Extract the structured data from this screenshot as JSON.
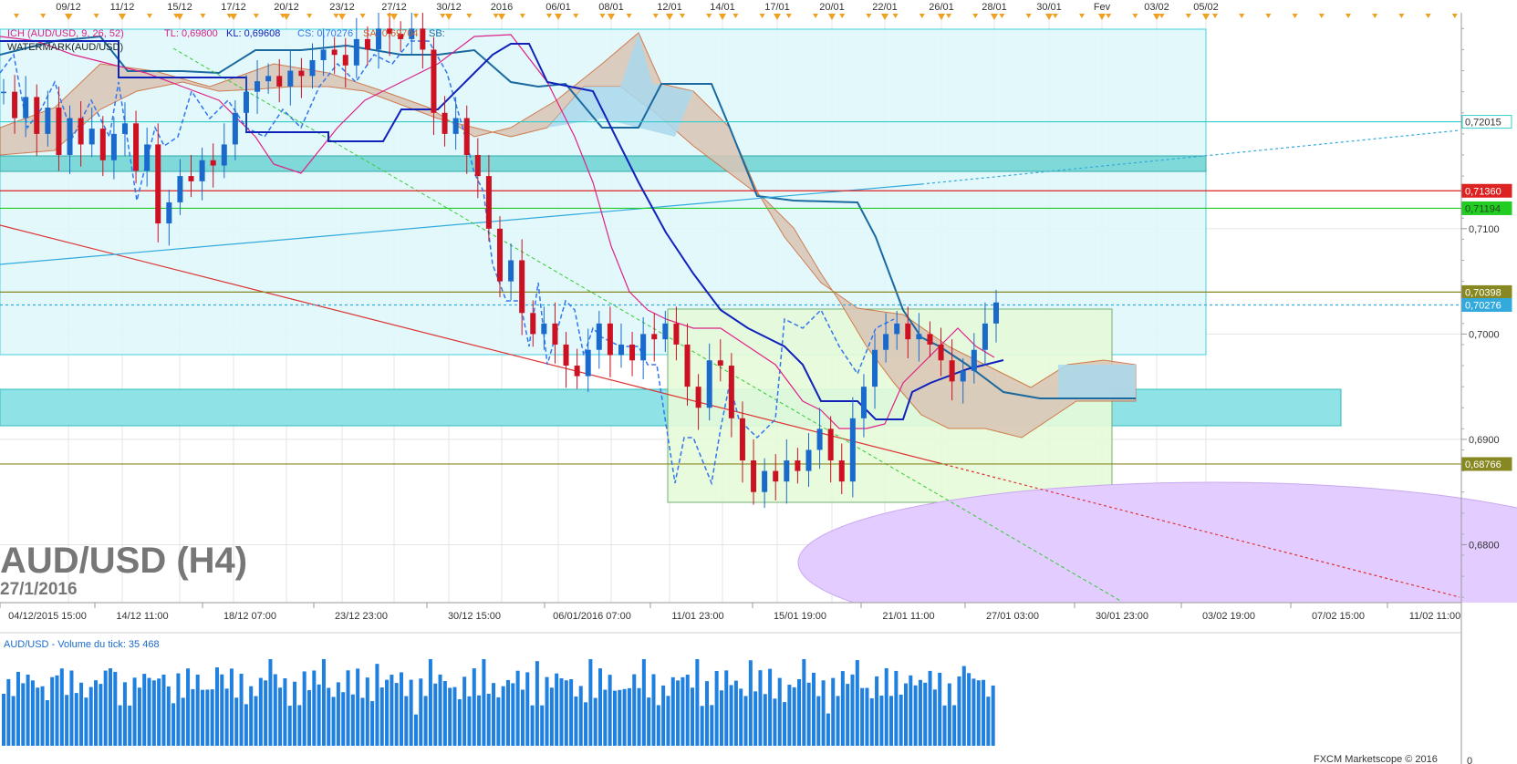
{
  "chart_data": {
    "type": "candlestick",
    "symbol_title": "AUD/USD (H4)",
    "date_label": "27/1/2016",
    "indicator_legend": {
      "ich": "ICH (AUD/USD, 9, 26, 52)",
      "tl": "TL: 0,69800",
      "kl": "KL: 0,69608",
      "cs": "CS: 0,70276",
      "sa": "SA: 0,69704",
      "sb": "SB:",
      "watermark": "WATERMARK(AUD/USD)"
    },
    "top_dates": [
      "09/12",
      "11/12",
      "15/12",
      "17/12",
      "20/12",
      "23/12",
      "27/12",
      "30/12",
      "2016",
      "06/01",
      "08/01",
      "12/01",
      "14/01",
      "17/01",
      "20/01",
      "22/01",
      "26/01",
      "28/01",
      "30/01",
      "Fev",
      "03/02",
      "05/02"
    ],
    "bottom_dates": [
      "04/12/2015 15:00",
      "14/12 11:00",
      "18/12 07:00",
      "23/12 23:00",
      "30/12 15:00",
      "06/01/2016 07:00",
      "11/01 23:00",
      "15/01 19:00",
      "21/01 11:00",
      "27/01 03:00",
      "30/01 23:00",
      "03/02 19:00",
      "07/02 15:00",
      "11/02 11:00"
    ],
    "y_ticks": [
      "0,7100",
      "0,7000",
      "0,6900",
      "0,6800"
    ],
    "ylim": [
      0.6745,
      0.7305
    ],
    "price_levels": [
      {
        "value": 0.72015,
        "label": "0,72015",
        "color": "#33cccc"
      },
      {
        "value": 0.7136,
        "label": "0,71360",
        "color": "#dd2222"
      },
      {
        "value": 0.71194,
        "label": "0,71194",
        "color": "#22cc22"
      },
      {
        "value": 0.70398,
        "label": "0,70398",
        "color": "#888822"
      },
      {
        "value": 0.70276,
        "label": "0,70276",
        "color": "#33aadd"
      },
      {
        "value": 0.68766,
        "label": "0,68766",
        "color": "#888822"
      }
    ],
    "close_path": [
      0.723,
      0.7205,
      0.7225,
      0.719,
      0.7215,
      0.717,
      0.7205,
      0.718,
      0.7195,
      0.7165,
      0.719,
      0.72,
      0.7155,
      0.718,
      0.7105,
      0.7125,
      0.715,
      0.7145,
      0.7165,
      0.716,
      0.718,
      0.721,
      0.723,
      0.724,
      0.7245,
      0.7235,
      0.725,
      0.7245,
      0.726,
      0.727,
      0.7265,
      0.7255,
      0.728,
      0.727,
      0.729,
      0.7285,
      0.728,
      0.729,
      0.727,
      0.721,
      0.719,
      0.7205,
      0.717,
      0.715,
      0.71,
      0.705,
      0.707,
      0.702,
      0.7,
      0.701,
      0.699,
      0.697,
      0.696,
      0.6985,
      0.701,
      0.698,
      0.699,
      0.6975,
      0.7,
      0.6995,
      0.701,
      0.699,
      0.695,
      0.693,
      0.6975,
      0.697,
      0.692,
      0.688,
      0.685,
      0.687,
      0.686,
      0.688,
      0.687,
      0.689,
      0.691,
      0.688,
      0.686,
      0.692,
      0.695,
      0.6985,
      0.7,
      0.701,
      0.6995,
      0.7,
      0.699,
      0.6975,
      0.6955,
      0.6965,
      0.6985,
      0.701,
      0.703
    ],
    "volume_title": "AUD/USD - Volume du tick: 35 468",
    "volume_axis_zero": "0",
    "copyright": "FXCM Marketscope © 2016"
  }
}
